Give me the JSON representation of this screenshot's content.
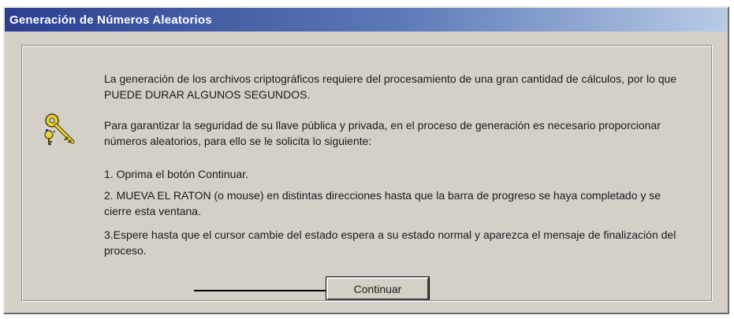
{
  "window": {
    "title": "Generación de Números Aleatorios"
  },
  "content": {
    "paragraph1": "La generación de los archivos criptográficos requiere del procesamiento de una gran cantidad de cálculos, por lo que PUEDE DURAR ALGUNOS SEGUNDOS.",
    "paragraph2": "Para garantizar la seguridad de su llave pública y privada, en el proceso de generación es necesario proporcionar números aleatorios, para ello se le solicita lo siguiente:",
    "step1": "1. Oprima el botón Continuar.",
    "step2": "2. MUEVA EL RATON (o mouse) en distintas direcciones hasta que la barra de progreso se haya completado y se cierre esta ventana.",
    "step3": "3.Espere hasta que el cursor cambie del estado espera a su estado normal y aparezca el mensaje de finalización del proceso."
  },
  "buttons": {
    "continue_label": "Continuar"
  },
  "icons": {
    "main": "keys-icon",
    "pointer": "arrow-icon"
  }
}
